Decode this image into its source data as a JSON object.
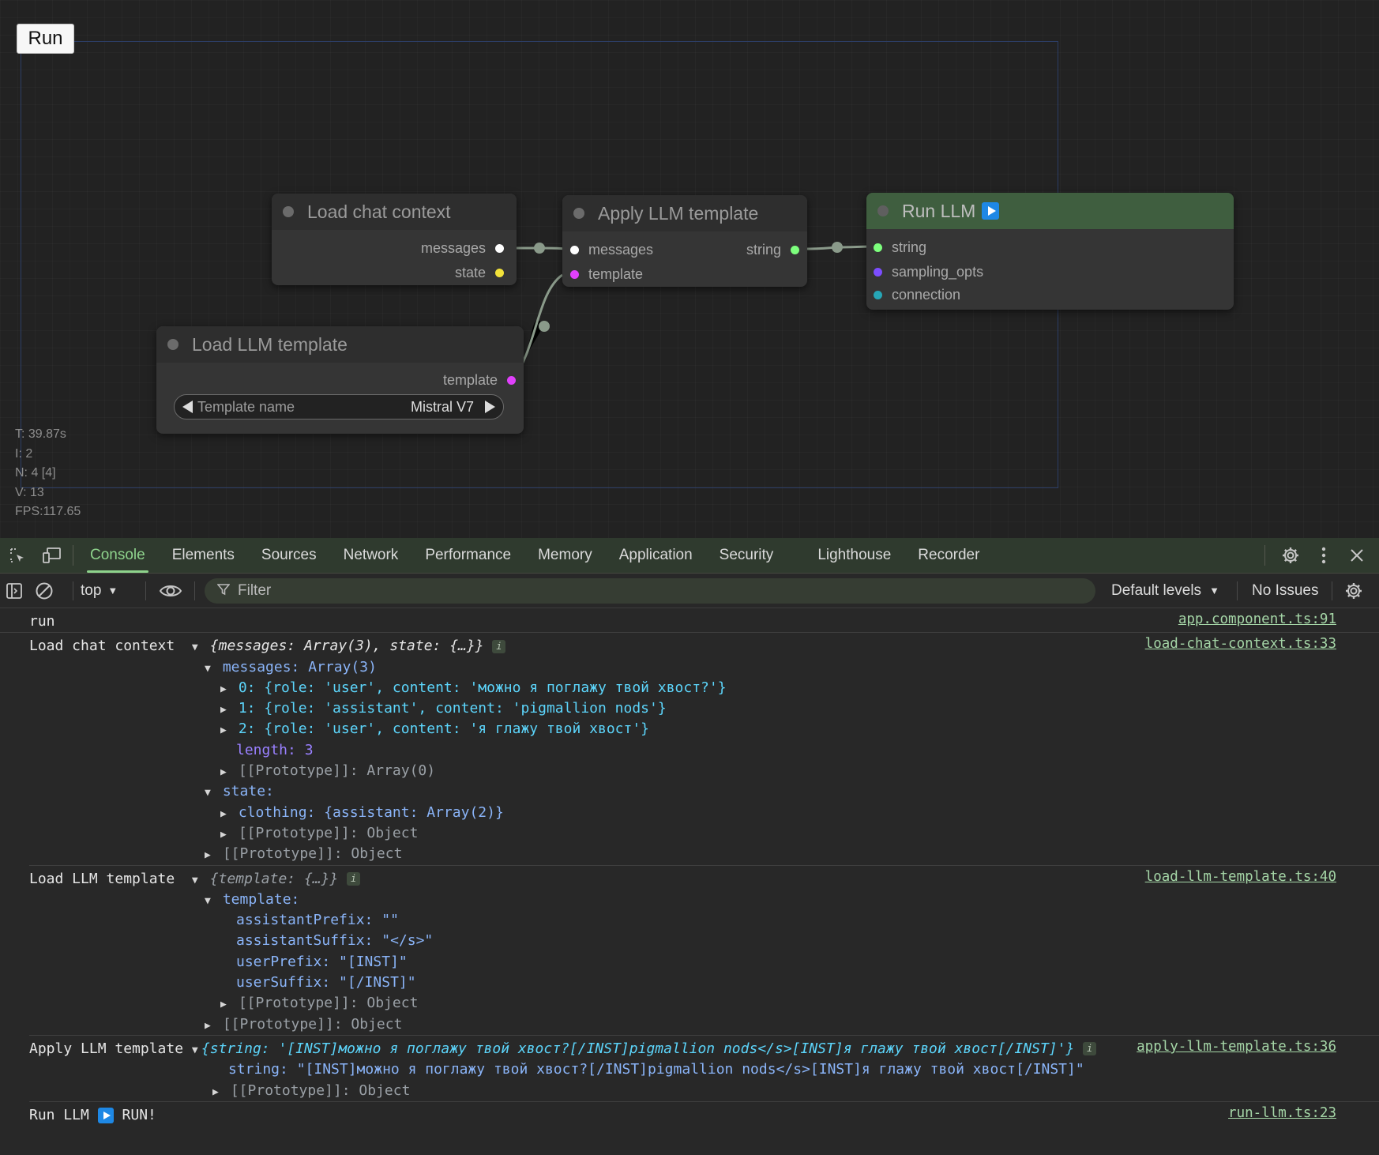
{
  "canvas": {
    "run_button": "Run",
    "stats": {
      "t": "T: 39.87s",
      "i": "I: 2",
      "n": "N: 4 [4]",
      "v": "V: 13",
      "fps": "FPS:117.65"
    },
    "nodes": {
      "load_chat": {
        "title": "Load chat context",
        "outputs": [
          "messages",
          "state"
        ]
      },
      "apply_template": {
        "title": "Apply LLM template",
        "inputs": [
          "messages",
          "template"
        ],
        "output": "string"
      },
      "run_llm": {
        "title": "Run LLM",
        "inputs": [
          "string",
          "sampling_opts",
          "connection"
        ]
      },
      "load_template": {
        "title": "Load LLM template",
        "output": "template",
        "widget_name": "Template name",
        "widget_value": "Mistral V7"
      }
    },
    "colors": {
      "messages": "#ffffff",
      "state": "#f2e23a",
      "template": "#e040fb",
      "string": "#7dff7d",
      "sampling_opts": "#7c4dff",
      "connection": "#26a6b6",
      "run_header": "#3f5e3f"
    }
  },
  "devtools": {
    "tabs": [
      "Console",
      "Elements",
      "Sources",
      "Network",
      "Performance",
      "Memory",
      "Application",
      "Security",
      "Lighthouse",
      "Recorder"
    ],
    "toolbar": {
      "context": "top",
      "filter_placeholder": "Filter",
      "levels": "Default levels",
      "issues": "No Issues"
    },
    "console": {
      "run": {
        "text": "run",
        "src": "app.component.ts:91"
      },
      "load_chat": {
        "label": "Load chat context",
        "src": "load-chat-context.ts:33",
        "summary": "{messages: Array(3), state: {…}}",
        "messages_header": "messages: Array(3)",
        "msg0": "0: {role: 'user', content: 'можно я поглажу твой хвост?'}",
        "msg1": "1: {role: 'assistant', content: 'pigmallion nods'}",
        "msg2": "2: {role: 'user', content: 'я глажу твой хвост'}",
        "length": "length: 3",
        "proto_array": "[[Prototype]]: Array(0)",
        "state": "state:",
        "clothing": "clothing: {assistant: Array(2)}",
        "proto_obj1": "[[Prototype]]: Object",
        "proto_obj2": "[[Prototype]]: Object"
      },
      "load_template": {
        "label": "Load LLM template",
        "src": "load-llm-template.ts:40",
        "summary": "{template: {…}}",
        "template": "template:",
        "assistantPrefix": "assistantPrefix: \"\"",
        "assistantSuffix": "assistantSuffix: \"</s>\"",
        "userPrefix": "userPrefix: \"[INST]\"",
        "userSuffix": "userSuffix: \"[/INST]\"",
        "proto1": "[[Prototype]]: Object",
        "proto2": "[[Prototype]]: Object"
      },
      "apply_template": {
        "label": "Apply LLM template",
        "src": "apply-llm-template.ts:36",
        "summary": "{string: '[INST]можно я поглажу твой хвост?[/INST]pigmallion nods</s>[INST]я глажу твой хвост[/INST]'}",
        "string": "string: \"[INST]можно я поглажу твой хвост?[/INST]pigmallion nods</s>[INST]я глажу твой хвост[/INST]\"",
        "proto": "[[Prototype]]: Object"
      },
      "run_llm": {
        "label": "Run LLM",
        "text": "RUN!",
        "src": "run-llm.ts:23"
      }
    }
  }
}
